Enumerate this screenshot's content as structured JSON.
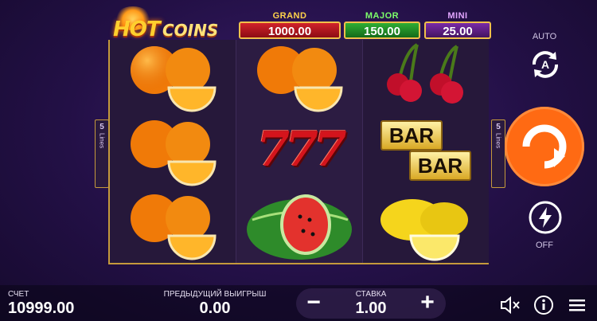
{
  "logo": {
    "hot": "HOT",
    "coins": "COINS"
  },
  "jackpots": [
    {
      "label": "GRAND",
      "value": "1000.00"
    },
    {
      "label": "MAJOR",
      "value": "150.00"
    },
    {
      "label": "MINI",
      "value": "25.00"
    }
  ],
  "lines": {
    "left_num": "5",
    "left_word": "Lines",
    "right_num": "5",
    "right_word": "Lines"
  },
  "reels": [
    [
      "orange",
      "orange",
      "orange"
    ],
    [
      "orange",
      "seven",
      "watermelon"
    ],
    [
      "cherry",
      "bar",
      "lemon"
    ]
  ],
  "symbols": {
    "seven_text": "777",
    "bar_top": "BAR",
    "bar_bottom": "BAR"
  },
  "controls": {
    "auto_label": "AUTO",
    "off_label": "OFF",
    "auto_icon": "autoplay-icon",
    "spin_icon": "spin-icon",
    "turbo_icon": "turbo-icon"
  },
  "bottom": {
    "balance_label": "СЧЕТ",
    "balance_value": "10999.00",
    "last_win_label": "ПРЕДЫДУЩИЙ ВЫИГРЫШ",
    "last_win_value": "0.00",
    "bet_label": "СТАВКА",
    "bet_value": "1.00",
    "minus": "−",
    "plus": "+"
  },
  "colors": {
    "accent": "#ff6a13",
    "gold": "#c59a3c",
    "bg": "#231046"
  }
}
